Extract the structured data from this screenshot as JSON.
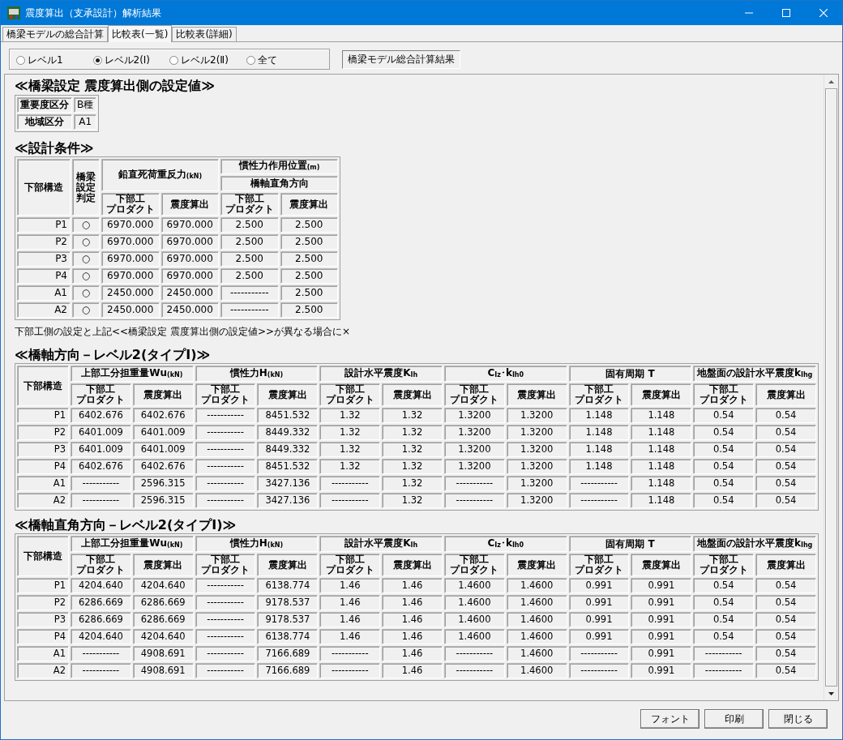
{
  "window": {
    "title": "震度算出（支承設計）解析結果"
  },
  "tabs": [
    {
      "label": "橋梁モデルの総合計算",
      "selected": false
    },
    {
      "label": "比較表(一覧)",
      "selected": true
    },
    {
      "label": "比較表(詳細)",
      "selected": false
    }
  ],
  "level_options": [
    {
      "label": "レベル1",
      "selected": false
    },
    {
      "label": "レベル2(Ⅰ)",
      "selected": true
    },
    {
      "label": "レベル2(Ⅱ)",
      "selected": false
    },
    {
      "label": "全て",
      "selected": false
    }
  ],
  "result_button": {
    "label": "橋梁モデル総合計算結果"
  },
  "sections": [
    {
      "kind": "settings",
      "heading": "≪橋梁設定 震度算出側の設定値≫",
      "rows": [
        [
          "重要度区分",
          "B種"
        ],
        [
          "地域区分",
          "A1"
        ]
      ]
    },
    {
      "kind": "conditions",
      "heading": "≪設計条件≫",
      "header_rows": [
        [
          {
            "text": "下部構造",
            "rowspan": 3
          },
          {
            "lines": [
              "橋梁",
              "設定",
              "判定"
            ],
            "rowspan": 3
          },
          {
            "text": "鉛直死荷重反力$_{(kN)}$",
            "colspan": 2,
            "rowspan": 2
          },
          {
            "text": "慣性力作用位置$_{(m)}$",
            "colspan": 2
          }
        ],
        [
          {
            "text": "橋軸直角方向",
            "colspan": 2
          }
        ],
        [
          {
            "lines": [
              "下部工",
              "プロダクト"
            ]
          },
          {
            "text": "震度算出"
          },
          {
            "lines": [
              "下部工",
              "プロダクト"
            ]
          },
          {
            "text": "震度算出"
          }
        ]
      ],
      "rows": [
        [
          "P1",
          "○",
          "6970.000",
          "6970.000",
          "2.500",
          "2.500"
        ],
        [
          "P2",
          "○",
          "6970.000",
          "6970.000",
          "2.500",
          "2.500"
        ],
        [
          "P3",
          "○",
          "6970.000",
          "6970.000",
          "2.500",
          "2.500"
        ],
        [
          "P4",
          "○",
          "6970.000",
          "6970.000",
          "2.500",
          "2.500"
        ],
        [
          "A1",
          "○",
          "2450.000",
          "2450.000",
          "-----------",
          "2.500"
        ],
        [
          "A2",
          "○",
          "2450.000",
          "2450.000",
          "-----------",
          "2.500"
        ]
      ]
    },
    {
      "kind": "note",
      "text": "下部工側の設定と上記<<橋梁設定 震度算出側の設定値>>が異なる場合に×"
    },
    {
      "kind": "results",
      "heading": "≪橋軸方向－レベル2(タイプI)≫",
      "header_rows": [
        [
          {
            "text": "下部構造",
            "rowspan": 2
          },
          {
            "text": "上部工分担重量Wu$_{(kN)}$",
            "colspan": 2
          },
          {
            "text": "慣性力H$_{(kN)}$",
            "colspan": 2
          },
          {
            "text": "設計水平震度K$_{Ih}$",
            "colspan": 2
          },
          {
            "text": "C$_{Iz}$･k$_{Ih0}$",
            "colspan": 2
          },
          {
            "text": "固有周期 T",
            "colspan": 2
          },
          {
            "text": "地盤面の設計水平震度k$_{Ihg}$",
            "colspan": 2
          }
        ],
        [
          {
            "lines": [
              "下部工",
              "プロダクト"
            ]
          },
          {
            "text": "震度算出"
          },
          {
            "lines": [
              "下部工",
              "プロダクト"
            ]
          },
          {
            "text": "震度算出"
          },
          {
            "lines": [
              "下部工",
              "プロダクト"
            ]
          },
          {
            "text": "震度算出"
          },
          {
            "lines": [
              "下部工",
              "プロダクト"
            ]
          },
          {
            "text": "震度算出"
          },
          {
            "lines": [
              "下部工",
              "プロダクト"
            ]
          },
          {
            "text": "震度算出"
          },
          {
            "lines": [
              "下部工",
              "プロダクト"
            ]
          },
          {
            "text": "震度算出"
          }
        ]
      ],
      "rows": [
        [
          "P1",
          "6402.676",
          "6402.676",
          "-----------",
          "8451.532",
          "1.32",
          "1.32",
          "1.3200",
          "1.3200",
          "1.148",
          "1.148",
          "0.54",
          "0.54"
        ],
        [
          "P2",
          "6401.009",
          "6401.009",
          "-----------",
          "8449.332",
          "1.32",
          "1.32",
          "1.3200",
          "1.3200",
          "1.148",
          "1.148",
          "0.54",
          "0.54"
        ],
        [
          "P3",
          "6401.009",
          "6401.009",
          "-----------",
          "8449.332",
          "1.32",
          "1.32",
          "1.3200",
          "1.3200",
          "1.148",
          "1.148",
          "0.54",
          "0.54"
        ],
        [
          "P4",
          "6402.676",
          "6402.676",
          "-----------",
          "8451.532",
          "1.32",
          "1.32",
          "1.3200",
          "1.3200",
          "1.148",
          "1.148",
          "0.54",
          "0.54"
        ],
        [
          "A1",
          "-----------",
          "2596.315",
          "-----------",
          "3427.136",
          "-----------",
          "1.32",
          "-----------",
          "1.3200",
          "-----------",
          "1.148",
          "0.54",
          "0.54"
        ],
        [
          "A2",
          "-----------",
          "2596.315",
          "-----------",
          "3427.136",
          "-----------",
          "1.32",
          "-----------",
          "1.3200",
          "-----------",
          "1.148",
          "0.54",
          "0.54"
        ]
      ]
    },
    {
      "kind": "results",
      "heading": "≪橋軸直角方向－レベル2(タイプI)≫",
      "header_rows": [
        [
          {
            "text": "下部構造",
            "rowspan": 2
          },
          {
            "text": "上部工分担重量Wu$_{(kN)}$",
            "colspan": 2
          },
          {
            "text": "慣性力H$_{(kN)}$",
            "colspan": 2
          },
          {
            "text": "設計水平震度K$_{Ih}$",
            "colspan": 2
          },
          {
            "text": "C$_{Iz}$･k$_{Ih0}$",
            "colspan": 2
          },
          {
            "text": "固有周期 T",
            "colspan": 2
          },
          {
            "text": "地盤面の設計水平震度k$_{Ihg}$",
            "colspan": 2
          }
        ],
        [
          {
            "lines": [
              "下部工",
              "プロダクト"
            ]
          },
          {
            "text": "震度算出"
          },
          {
            "lines": [
              "下部工",
              "プロダクト"
            ]
          },
          {
            "text": "震度算出"
          },
          {
            "lines": [
              "下部工",
              "プロダクト"
            ]
          },
          {
            "text": "震度算出"
          },
          {
            "lines": [
              "下部工",
              "プロダクト"
            ]
          },
          {
            "text": "震度算出"
          },
          {
            "lines": [
              "下部工",
              "プロダクト"
            ]
          },
          {
            "text": "震度算出"
          },
          {
            "lines": [
              "下部工",
              "プロダクト"
            ]
          },
          {
            "text": "震度算出"
          }
        ]
      ],
      "rows": [
        [
          "P1",
          "4204.640",
          "4204.640",
          "-----------",
          "6138.774",
          "1.46",
          "1.46",
          "1.4600",
          "1.4600",
          "0.991",
          "0.991",
          "0.54",
          "0.54"
        ],
        [
          "P2",
          "6286.669",
          "6286.669",
          "-----------",
          "9178.537",
          "1.46",
          "1.46",
          "1.4600",
          "1.4600",
          "0.991",
          "0.991",
          "0.54",
          "0.54"
        ],
        [
          "P3",
          "6286.669",
          "6286.669",
          "-----------",
          "9178.537",
          "1.46",
          "1.46",
          "1.4600",
          "1.4600",
          "0.991",
          "0.991",
          "0.54",
          "0.54"
        ],
        [
          "P4",
          "4204.640",
          "4204.640",
          "-----------",
          "6138.774",
          "1.46",
          "1.46",
          "1.4600",
          "1.4600",
          "0.991",
          "0.991",
          "0.54",
          "0.54"
        ],
        [
          "A1",
          "-----------",
          "4908.691",
          "-----------",
          "7166.689",
          "-----------",
          "1.46",
          "-----------",
          "1.4600",
          "-----------",
          "0.991",
          "-----------",
          "0.54"
        ],
        [
          "A2",
          "-----------",
          "4908.691",
          "-----------",
          "7166.689",
          "-----------",
          "1.46",
          "-----------",
          "1.4600",
          "-----------",
          "0.991",
          "-----------",
          "0.54"
        ]
      ]
    }
  ],
  "buttons": [
    "フォント",
    "印刷",
    "閉じる"
  ]
}
